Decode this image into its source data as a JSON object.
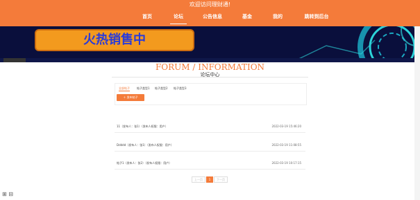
{
  "header": {
    "welcome": "欢迎访问理财通!",
    "nav": [
      {
        "label": "首页",
        "active": false
      },
      {
        "label": "论坛",
        "active": true
      },
      {
        "label": "公告信息",
        "active": false
      },
      {
        "label": "基金",
        "active": false
      },
      {
        "label": "我的",
        "active": false
      },
      {
        "label": "跳转到后台",
        "active": false
      }
    ]
  },
  "banner": {
    "slogan": "火热销售中",
    "slides": 3,
    "active_slide": 2
  },
  "forum": {
    "title_en": "FORUM / INFORMATION",
    "title_cn": "论坛中心",
    "tabs": [
      "全部帖子",
      "帖子类型1",
      "帖子类型2",
      "帖子类型3"
    ],
    "post_button": "发布帖子",
    "posts": [
      {
        "title": "11（发布人：张1）（发布人权限：用户）",
        "time": "2022-03-19 15:46:20"
      },
      {
        "title": "Ddddd（发布人：张1）（发布人权限：用户）",
        "time": "2022-03-19 11:08:55"
      },
      {
        "title": "帖子1（发布人：张2）（发布人权限：用户）",
        "time": "2022-03-19 10:17:15"
      }
    ]
  },
  "pagination": {
    "prev": "上一页",
    "current": "1",
    "next": "下一页"
  },
  "colors": {
    "accent": "#f47b3a",
    "banner_bg": "#0a0f3c"
  }
}
